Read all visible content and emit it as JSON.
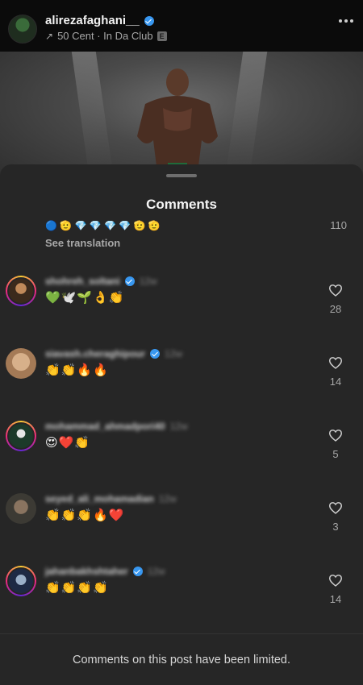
{
  "post": {
    "username": "alirezafaghani__",
    "music_title": "50 Cent · In Da Club",
    "explicit_badge": "E"
  },
  "sheet": {
    "title": "Comments"
  },
  "previous_comment": {
    "emoji_strip": "🔵 🫡 💎 💎 💎 💎 🫡 🫡",
    "likes": "110",
    "see_translation": "See translation"
  },
  "comments": [
    {
      "username": "shohreh_soltani",
      "verified": true,
      "time": "12w",
      "text": "💚🕊️🌱👌👏",
      "likes": "28"
    },
    {
      "username": "siavash.cheraghipour",
      "verified": true,
      "time": "12w",
      "text": "👏👏🔥🔥",
      "likes": "14"
    },
    {
      "username": "mohammad_ahmadpori40",
      "verified": false,
      "time": "12w",
      "text": "😍❤️👏",
      "likes": "5"
    },
    {
      "username": "seyed_ali_mohamadian",
      "verified": false,
      "time": "12w",
      "text": "👏👏👏🔥❤️",
      "likes": "3"
    },
    {
      "username": "jahanbakhshtaher",
      "verified": true,
      "time": "12w",
      "text": "👏👏👏👏",
      "likes": "14"
    }
  ],
  "footer": {
    "text": "Comments on this post have been limited."
  },
  "colors": {
    "sheet_background": "#262626",
    "verified_blue": "#3897f0",
    "secondary_text": "#a8a8a8"
  }
}
